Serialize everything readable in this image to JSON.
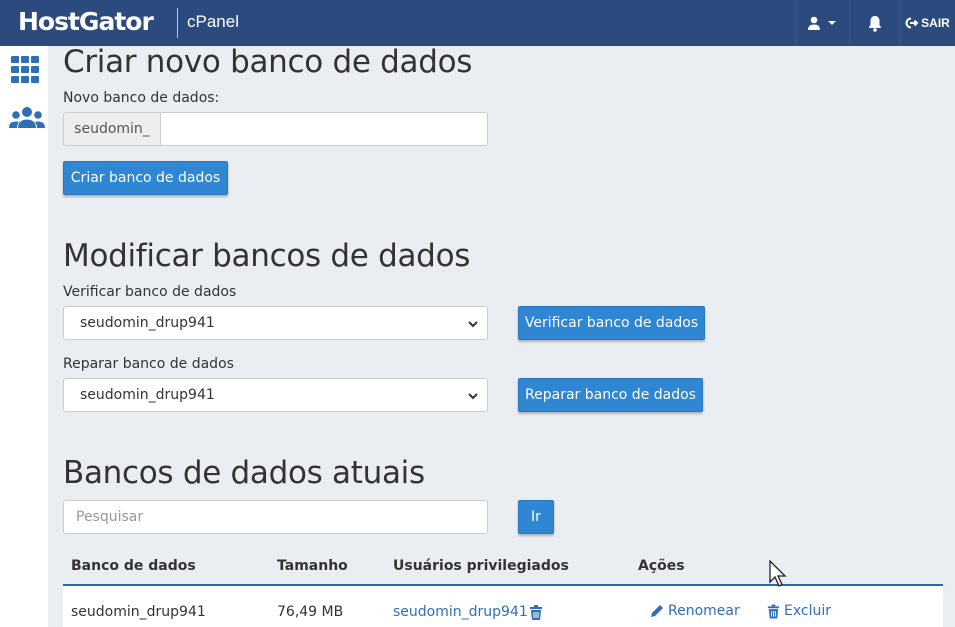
{
  "header": {
    "brand": "HostGator",
    "product": "cPanel",
    "logout_label": "SAIR"
  },
  "sidebar": {
    "items": [
      {
        "icon": "grid-icon"
      },
      {
        "icon": "users-icon"
      }
    ]
  },
  "create": {
    "heading": "Criar novo banco de dados",
    "field_label": "Novo banco de dados:",
    "prefix": "seudomin_",
    "input_value": "",
    "button_label": "Criar banco de dados"
  },
  "modify": {
    "heading": "Modificar bancos de dados",
    "check_label": "Verificar banco de dados",
    "check_selected": "seudomin_drup941",
    "check_button": "Verificar banco de dados",
    "repair_label": "Reparar banco de dados",
    "repair_selected": "seudomin_drup941",
    "repair_button": "Reparar banco de dados"
  },
  "current": {
    "heading": "Bancos de dados atuais",
    "search_placeholder": "Pesquisar",
    "go_button": "Ir",
    "columns": [
      "Banco de dados",
      "Tamanho",
      "Usuários privilegiados",
      "Ações"
    ],
    "rows": [
      {
        "database": "seudomin_drup941",
        "size": "76,49 MB",
        "user": "seudomin_drup941",
        "rename_label": "Renomear",
        "delete_label": "Excluir"
      }
    ]
  },
  "colors": {
    "header_bg": "#2b4a7d",
    "button_bg": "#2f86d3",
    "link": "#2f6fb3",
    "page_bg": "#eaeef3"
  }
}
